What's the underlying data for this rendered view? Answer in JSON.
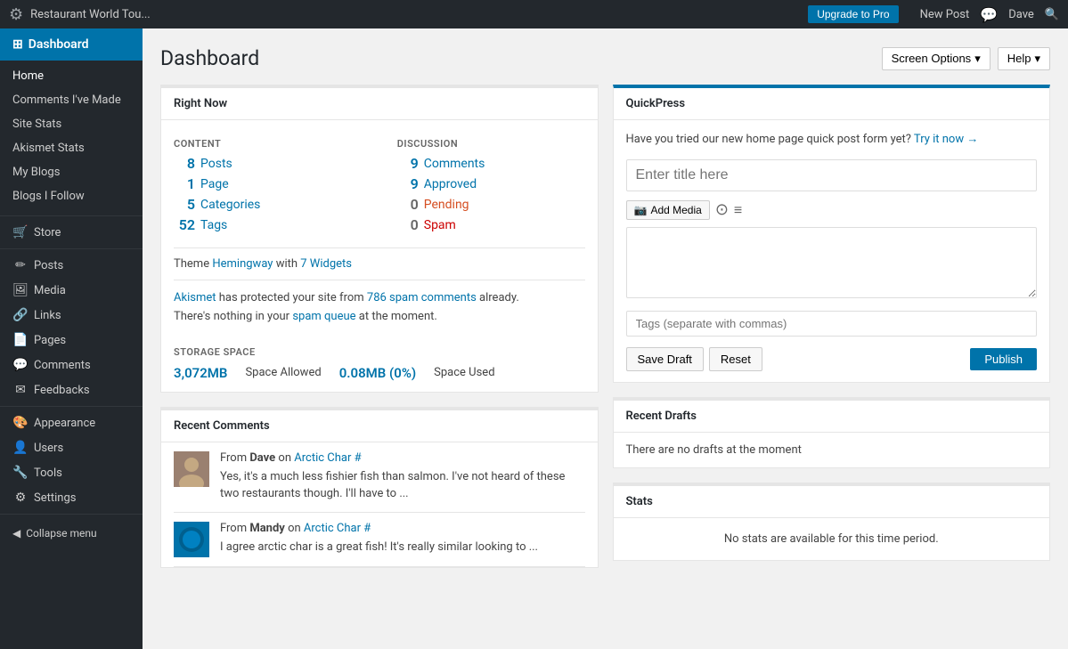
{
  "adminBar": {
    "wpLogo": "⚙",
    "siteName": "Restaurant World Tou...",
    "upgradeBtnLabel": "Upgrade to Pro",
    "newPostLabel": "New Post",
    "commentIconLabel": "💬",
    "userName": "Dave",
    "searchIcon": "🔍"
  },
  "sidebar": {
    "dashboardLabel": "Dashboard",
    "dashboardIcon": "⊞",
    "navItems": [
      {
        "label": "Home",
        "icon": "",
        "active": true,
        "group": "main"
      },
      {
        "label": "Comments I've Made",
        "icon": "",
        "active": false,
        "group": "main"
      },
      {
        "label": "Site Stats",
        "icon": "",
        "active": false,
        "group": "main"
      },
      {
        "label": "Akismet Stats",
        "icon": "",
        "active": false,
        "group": "main"
      },
      {
        "label": "My Blogs",
        "icon": "",
        "active": false,
        "group": "main"
      },
      {
        "label": "Blogs I Follow",
        "icon": "",
        "active": false,
        "group": "main"
      },
      {
        "label": "Store",
        "icon": "🛒",
        "active": false,
        "group": "section"
      },
      {
        "label": "Posts",
        "icon": "✏",
        "active": false,
        "group": "section"
      },
      {
        "label": "Media",
        "icon": "🖼",
        "active": false,
        "group": "section"
      },
      {
        "label": "Links",
        "icon": "🔗",
        "active": false,
        "group": "section"
      },
      {
        "label": "Pages",
        "icon": "📄",
        "active": false,
        "group": "section"
      },
      {
        "label": "Comments",
        "icon": "💬",
        "active": false,
        "group": "section"
      },
      {
        "label": "Feedbacks",
        "icon": "✉",
        "active": false,
        "group": "section"
      },
      {
        "label": "Appearance",
        "icon": "🎨",
        "active": false,
        "group": "section"
      },
      {
        "label": "Users",
        "icon": "👤",
        "active": false,
        "group": "section"
      },
      {
        "label": "Tools",
        "icon": "🔧",
        "active": false,
        "group": "section"
      },
      {
        "label": "Settings",
        "icon": "⚙",
        "active": false,
        "group": "section"
      }
    ],
    "collapseLabel": "Collapse menu",
    "collapseIcon": "◀"
  },
  "header": {
    "title": "Dashboard",
    "screenOptionsLabel": "Screen Options",
    "helpLabel": "Help"
  },
  "rightNow": {
    "title": "Right Now",
    "contentHeader": "CONTENT",
    "discussionHeader": "DISCUSSION",
    "contentItems": [
      {
        "num": "8",
        "label": "Posts",
        "numClass": "blue",
        "labelClass": "blue"
      },
      {
        "num": "1",
        "label": "Page",
        "numClass": "blue",
        "labelClass": "blue"
      },
      {
        "num": "5",
        "label": "Categories",
        "numClass": "blue",
        "labelClass": "blue"
      },
      {
        "num": "52",
        "label": "Tags",
        "numClass": "blue",
        "labelClass": "blue"
      }
    ],
    "discussionItems": [
      {
        "num": "9",
        "label": "Comments",
        "numClass": "blue",
        "labelClass": "blue"
      },
      {
        "num": "9",
        "label": "Approved",
        "numClass": "blue",
        "labelClass": "blue"
      },
      {
        "num": "0",
        "label": "Pending",
        "numClass": "gray",
        "labelClass": "orange"
      },
      {
        "num": "0",
        "label": "Spam",
        "numClass": "gray",
        "labelClass": "red"
      }
    ],
    "themeText": "Theme",
    "themeName": "Hemingway",
    "themeWith": "with",
    "widgetsLink": "7 Widgets",
    "akismetPre": "",
    "akismetLink": "Akismet",
    "akismetMid": "has protected your site from",
    "spamLink": "786 spam comments",
    "akismetPost": "already.",
    "akismetLine2Pre": "There's nothing in your",
    "spamQueueLink": "spam queue",
    "akismetLine2Post": "at the moment.",
    "storageHeader": "STORAGE SPACE",
    "storageAllowed": "3,072MB",
    "storageAllowedLabel": "Space Allowed",
    "storageUsed": "0.08MB (0%)",
    "storageUsedLabel": "Space Used"
  },
  "recentComments": {
    "title": "Recent Comments",
    "comments": [
      {
        "from": "From",
        "author": "Dave",
        "on": "on",
        "postLink": "Arctic Char #",
        "text": "Yes, it's a much less fishier fish than salmon. I've not heard of these two restaurants though. I'll have to ...",
        "avatarType": "img",
        "avatarBg": "#7a6655"
      },
      {
        "from": "From",
        "author": "Mandy",
        "on": "on",
        "postLink": "Arctic Char #",
        "text": "I agree arctic char is a great fish! It's really similar looking to ...",
        "avatarType": "icon",
        "avatarBg": "#0073aa"
      }
    ]
  },
  "quickPress": {
    "title": "QuickPress",
    "introText": "Have you tried our new home page quick post form yet?",
    "tryItLink": "Try it now →",
    "titlePlaceholder": "Enter title here",
    "addMediaLabel": "Add Media",
    "mediaIcon": "📷",
    "toolbarIcon1": "⊙",
    "toolbarIcon2": "≡",
    "tagsPlaceholder": "Tags (separate with commas)",
    "saveDraftLabel": "Save Draft",
    "resetLabel": "Reset",
    "publishLabel": "Publish"
  },
  "recentDrafts": {
    "title": "Recent Drafts",
    "emptyText": "There are no drafts at the moment"
  },
  "stats": {
    "title": "Stats",
    "emptyText": "No stats are available for this time period."
  }
}
